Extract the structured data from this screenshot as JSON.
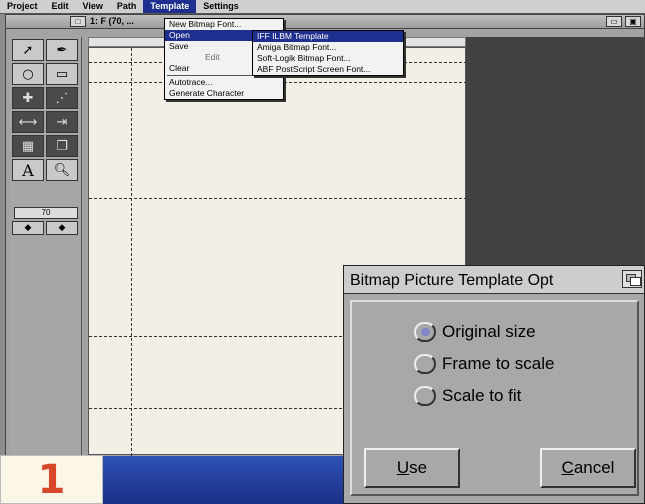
{
  "menubar": {
    "items": [
      "Project",
      "Edit",
      "View",
      "Path",
      "Template",
      "Settings"
    ],
    "active_index": 4
  },
  "window": {
    "title": "1: F (70, ..."
  },
  "toolbox": {
    "zoom_value": "70"
  },
  "template_menu": {
    "items": [
      {
        "label": "New Bitmap Font...",
        "state": "normal"
      },
      {
        "label": "Open",
        "state": "highlight"
      },
      {
        "label": "Save",
        "state": "normal"
      },
      {
        "label": "Edit",
        "state": "disabled"
      },
      {
        "label": "Clear",
        "state": "normal"
      },
      {
        "label": "Autotrace...",
        "state": "normal"
      },
      {
        "label": "Generate Character",
        "state": "normal"
      }
    ]
  },
  "open_submenu": {
    "items": [
      {
        "label": "IFF ILBM Template",
        "state": "highlight"
      },
      {
        "label": "Amiga Bitmap Font...",
        "state": "normal"
      },
      {
        "label": "Soft-Logik Bitmap Font...",
        "state": "normal"
      },
      {
        "label": "ABF PostScript Screen Font...",
        "state": "normal"
      }
    ]
  },
  "dialog": {
    "title": "Bitmap Picture Template Opt",
    "options": [
      {
        "label": "Original size",
        "selected": true
      },
      {
        "label": "Frame to scale",
        "selected": false
      },
      {
        "label": "Scale to fit",
        "selected": false
      }
    ],
    "use_button": {
      "mnemonic": "U",
      "rest": "se"
    },
    "cancel_button": {
      "mnemonic": "C",
      "rest": "ancel"
    }
  },
  "badge": {
    "number": "1"
  },
  "colors": {
    "highlight": "#1f2f8f",
    "radio_dot": "#7f86c9",
    "badge_digit": "#d8472a"
  }
}
